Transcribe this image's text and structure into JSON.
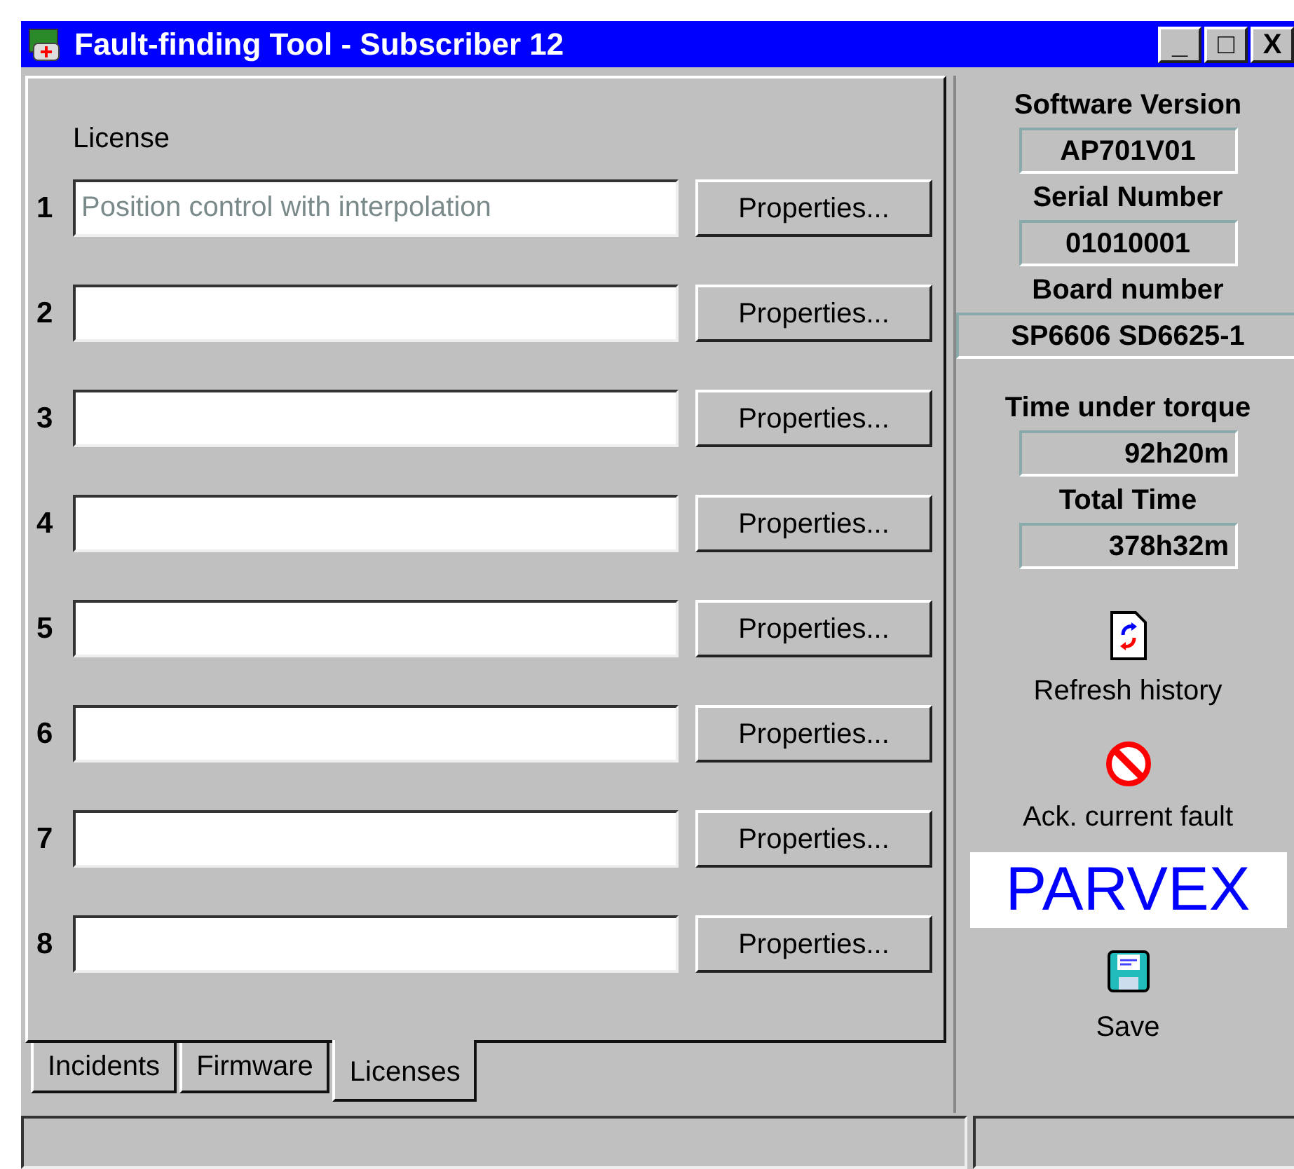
{
  "window": {
    "title": "Fault-finding Tool - Subscriber 12",
    "controls": [
      "_",
      "□",
      "X"
    ]
  },
  "licenses": {
    "heading": "License",
    "rows": [
      {
        "number": "1",
        "value": "Position control with interpolation",
        "button": "Properties..."
      },
      {
        "number": "2",
        "button": "Properties..."
      },
      {
        "number": "3",
        "button": "Properties..."
      },
      {
        "number": "4",
        "button": "Properties..."
      },
      {
        "number": "5",
        "button": "Properties..."
      },
      {
        "number": "6",
        "button": "Properties..."
      },
      {
        "number": "7",
        "button": "Properties..."
      },
      {
        "number": "8",
        "button": "Properties..."
      }
    ]
  },
  "tabs": [
    {
      "label": "Incidents",
      "selected": false
    },
    {
      "label": "Firmware",
      "selected": false
    },
    {
      "label": "Licenses",
      "selected": true
    }
  ],
  "info": [
    {
      "kind": "centered",
      "label": "Software Version",
      "value": "AP701V01"
    },
    {
      "kind": "centered",
      "label": "Serial Number",
      "value": "01010001"
    },
    {
      "kind": "wide",
      "label": "Board number",
      "value": "SP6606 SD6625-1"
    },
    {
      "kind": "right",
      "label": "Time under torque",
      "value": "92h20m"
    },
    {
      "kind": "right",
      "label": "Total Time",
      "value": "378h32m"
    }
  ],
  "actions": [
    {
      "kind": "refresh",
      "label": "Refresh history"
    },
    {
      "kind": "ack",
      "label": "Ack. current fault"
    }
  ],
  "logo": "PARVEX",
  "save": {
    "label": "Save"
  }
}
